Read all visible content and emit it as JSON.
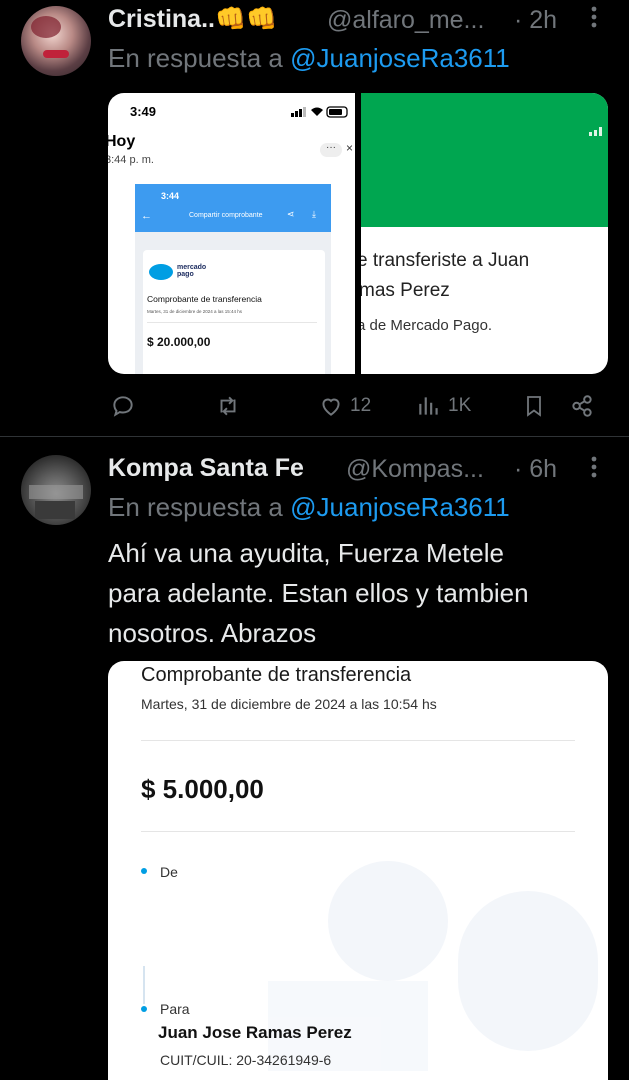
{
  "tweet1": {
    "name": "Cristina..👊👊",
    "handle": "@alfaro_me...",
    "time": "· 2h",
    "reply_prefix": "En respuesta a",
    "reply_to": "@JuanjoseRa3611",
    "media_left": {
      "status_time": "3:49",
      "hoy": "Hoy",
      "hoy_time": "3:44 p. m.",
      "inner_time": "3:44",
      "inner_title": "Compartir comprobante",
      "brand": "mercado pago",
      "doc_title": "Comprobante de transferencia",
      "doc_date": "Martes, 31 de diciembre de 2024 a las 15:44 hs",
      "amount": "$ 20.000,00"
    },
    "media_right": {
      "line1": "e transferiste a Juan",
      "line2": "mas Perez",
      "line3": "a de Mercado Pago."
    },
    "actions": {
      "reply_count": "",
      "retweet_count": "",
      "like_count": "12",
      "views_count": "1K"
    }
  },
  "tweet2": {
    "name": "Kompa Santa Fe",
    "handle": "@Kompas...",
    "time": "· 6h",
    "reply_prefix": "En respuesta a",
    "reply_to": "@JuanjoseRa3611",
    "text_lines": [
      "Ahí va una ayudita, Fuerza Metele",
      "para adelante. Estan ellos y tambien",
      "nosotros. Abrazos"
    ],
    "receipt": {
      "title": "Comprobante de transferencia",
      "date": "Martes, 31 de diciembre de 2024 a las 10:54 hs",
      "amount": "$ 5.000,00",
      "from_label": "De",
      "to_label": "Para",
      "to_name": "Juan Jose Ramas Perez",
      "cuit": "CUIT/CUIL: 20-34261949-6"
    }
  },
  "colors": {
    "background": "#000000",
    "link": "#1d9bf0",
    "muted": "#71767b",
    "mp_green": "#00a650",
    "mp_blue": "#009ee3"
  }
}
